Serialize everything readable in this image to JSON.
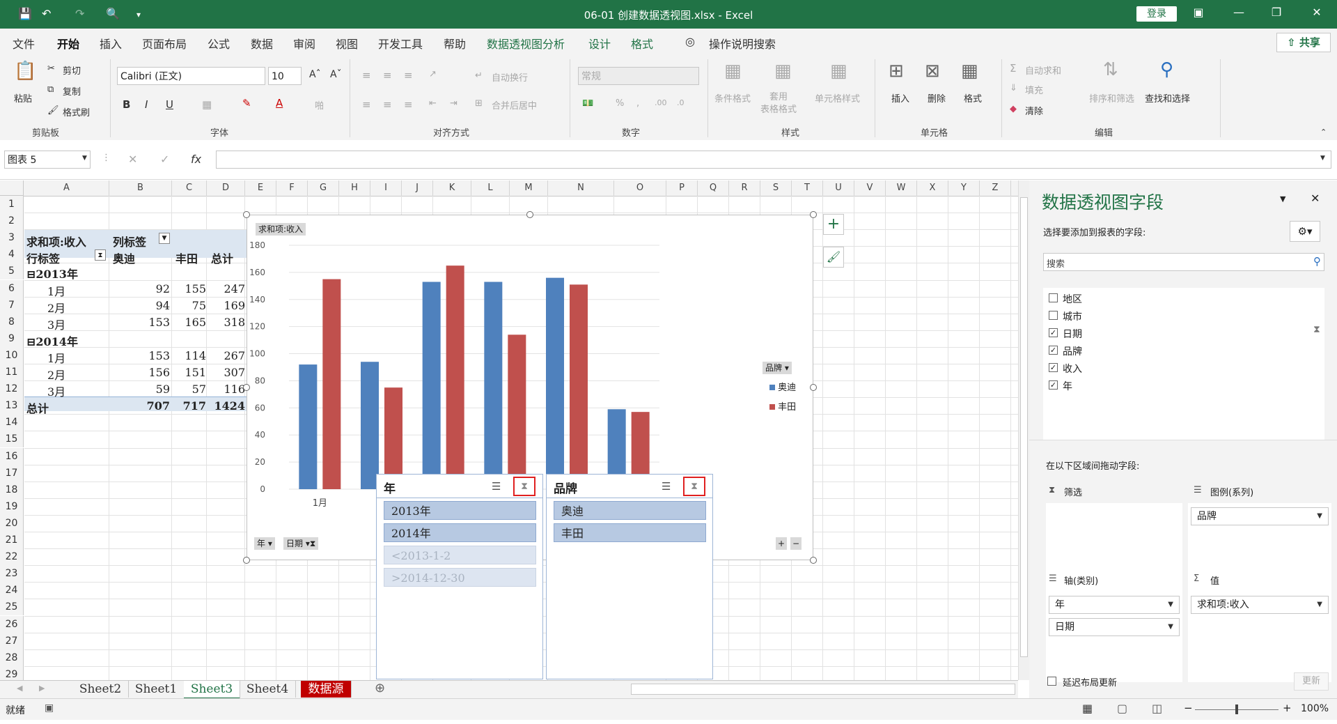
{
  "window": {
    "title": "06-01 创建数据透视图.xlsx  -  Excel",
    "login_label": "登录"
  },
  "menu": {
    "items": [
      "文件",
      "开始",
      "插入",
      "页面布局",
      "公式",
      "数据",
      "审阅",
      "视图",
      "开发工具",
      "帮助"
    ],
    "context_items": [
      "数据透视图分析",
      "设计",
      "格式"
    ],
    "search": "操作说明搜索",
    "share": "共享"
  },
  "ribbon": {
    "clipboard": {
      "paste": "粘贴",
      "cut": "剪切",
      "copy": "复制",
      "format_painter": "格式刷",
      "group": "剪贴板"
    },
    "font": {
      "name": "Calibri (正文)",
      "size": "10",
      "group": "字体"
    },
    "align": {
      "wrap": "自动换行",
      "merge": "合并后居中",
      "group": "对齐方式"
    },
    "number": {
      "format": "常规",
      "group": "数字"
    },
    "styles": {
      "cond": "条件格式",
      "table": "套用\n表格格式",
      "cell": "单元格样式",
      "group": "样式"
    },
    "cells": {
      "insert": "插入",
      "delete": "删除",
      "format": "格式",
      "group": "单元格"
    },
    "edit": {
      "autosum": "自动求和",
      "fill": "填充",
      "clear": "清除",
      "sort": "排序和筛选",
      "find": "查找和选择",
      "group": "编辑"
    }
  },
  "formula_bar": {
    "name_box": "图表 5",
    "fx": "fx",
    "value": ""
  },
  "columns": [
    "A",
    "B",
    "C",
    "D",
    "E",
    "F",
    "G",
    "H",
    "I",
    "J",
    "K",
    "L",
    "M",
    "N",
    "O",
    "P",
    "Q",
    "R",
    "S",
    "T",
    "U",
    "V",
    "W",
    "X",
    "Y",
    "Z"
  ],
  "rows": [
    "1",
    "2",
    "3",
    "4",
    "5",
    "6",
    "7",
    "8",
    "9",
    "10",
    "11",
    "12",
    "13",
    "14",
    "15",
    "16",
    "17",
    "18",
    "19",
    "20",
    "21",
    "22",
    "23",
    "24",
    "25",
    "26",
    "27",
    "28",
    "29"
  ],
  "pivot": {
    "value_header": "求和项:收入",
    "col_label": "列标签",
    "row_label": "行标签",
    "brands": [
      "奥迪",
      "丰田",
      "总计"
    ],
    "rows": [
      {
        "label": "2013年",
        "type": "group"
      },
      {
        "label": "1月",
        "v": [
          "92",
          "155",
          "247"
        ]
      },
      {
        "label": "2月",
        "v": [
          "94",
          "75",
          "169"
        ]
      },
      {
        "label": "3月",
        "v": [
          "153",
          "165",
          "318"
        ]
      },
      {
        "label": "2014年",
        "type": "group"
      },
      {
        "label": "1月",
        "v": [
          "153",
          "114",
          "267"
        ]
      },
      {
        "label": "2月",
        "v": [
          "156",
          "151",
          "307"
        ]
      },
      {
        "label": "3月",
        "v": [
          "59",
          "57",
          "116"
        ]
      },
      {
        "label": "总计",
        "v": [
          "707",
          "717",
          "1424"
        ],
        "type": "total"
      }
    ]
  },
  "chart_data": {
    "type": "bar",
    "title": "",
    "value_field_button": "求和项:收入",
    "categories": [
      "1月",
      "2月",
      "3月",
      "1月",
      "2月",
      "3月"
    ],
    "visible_category_labels": [
      "1月",
      "月"
    ],
    "series": [
      {
        "name": "奥迪",
        "color": "#4f81bd",
        "values": [
          92,
          94,
          153,
          153,
          156,
          59
        ]
      },
      {
        "name": "丰田",
        "color": "#c0504d",
        "values": [
          155,
          75,
          165,
          114,
          151,
          57
        ]
      }
    ],
    "ylim": [
      0,
      180
    ],
    "yticks": [
      "0",
      "20",
      "40",
      "60",
      "80",
      "100",
      "120",
      "140",
      "160",
      "180"
    ],
    "legend_title": "品牌",
    "legend_position": "right",
    "axis_buttons": [
      "年",
      "日期"
    ],
    "grid": true
  },
  "slicers": [
    {
      "title": "年",
      "items": [
        {
          "label": "2013年",
          "selected": true
        },
        {
          "label": "2014年",
          "selected": true
        },
        {
          "label": "<2013-1-2",
          "selected": false
        },
        {
          "label": ">2014-12-30",
          "selected": false
        }
      ]
    },
    {
      "title": "品牌",
      "items": [
        {
          "label": "奥迪",
          "selected": true
        },
        {
          "label": "丰田",
          "selected": true
        }
      ]
    }
  ],
  "panel": {
    "title": "数据透视图字段",
    "subtitle": "选择要添加到报表的字段:",
    "search_placeholder": "搜索",
    "fields": [
      {
        "name": "地区",
        "checked": false
      },
      {
        "name": "城市",
        "checked": false
      },
      {
        "name": "日期",
        "checked": true
      },
      {
        "name": "品牌",
        "checked": true
      },
      {
        "name": "收入",
        "checked": true
      },
      {
        "name": "年",
        "checked": true
      }
    ],
    "drag_label": "在以下区域间拖动字段:",
    "filter_label": "筛选",
    "legend_label": "图例(系列)",
    "legend_item": "品牌",
    "axis_label": "轴(类别)",
    "axis_items": [
      "年",
      "日期"
    ],
    "values_label": "值",
    "values_item": "求和项:收入",
    "defer_label": "延迟布局更新",
    "update_label": "更新"
  },
  "sheets": {
    "tabs": [
      "Sheet2",
      "Sheet1",
      "Sheet3",
      "Sheet4",
      "数据源"
    ],
    "active": "Sheet3"
  },
  "status": {
    "ready": "就绪",
    "zoom": "100%"
  }
}
